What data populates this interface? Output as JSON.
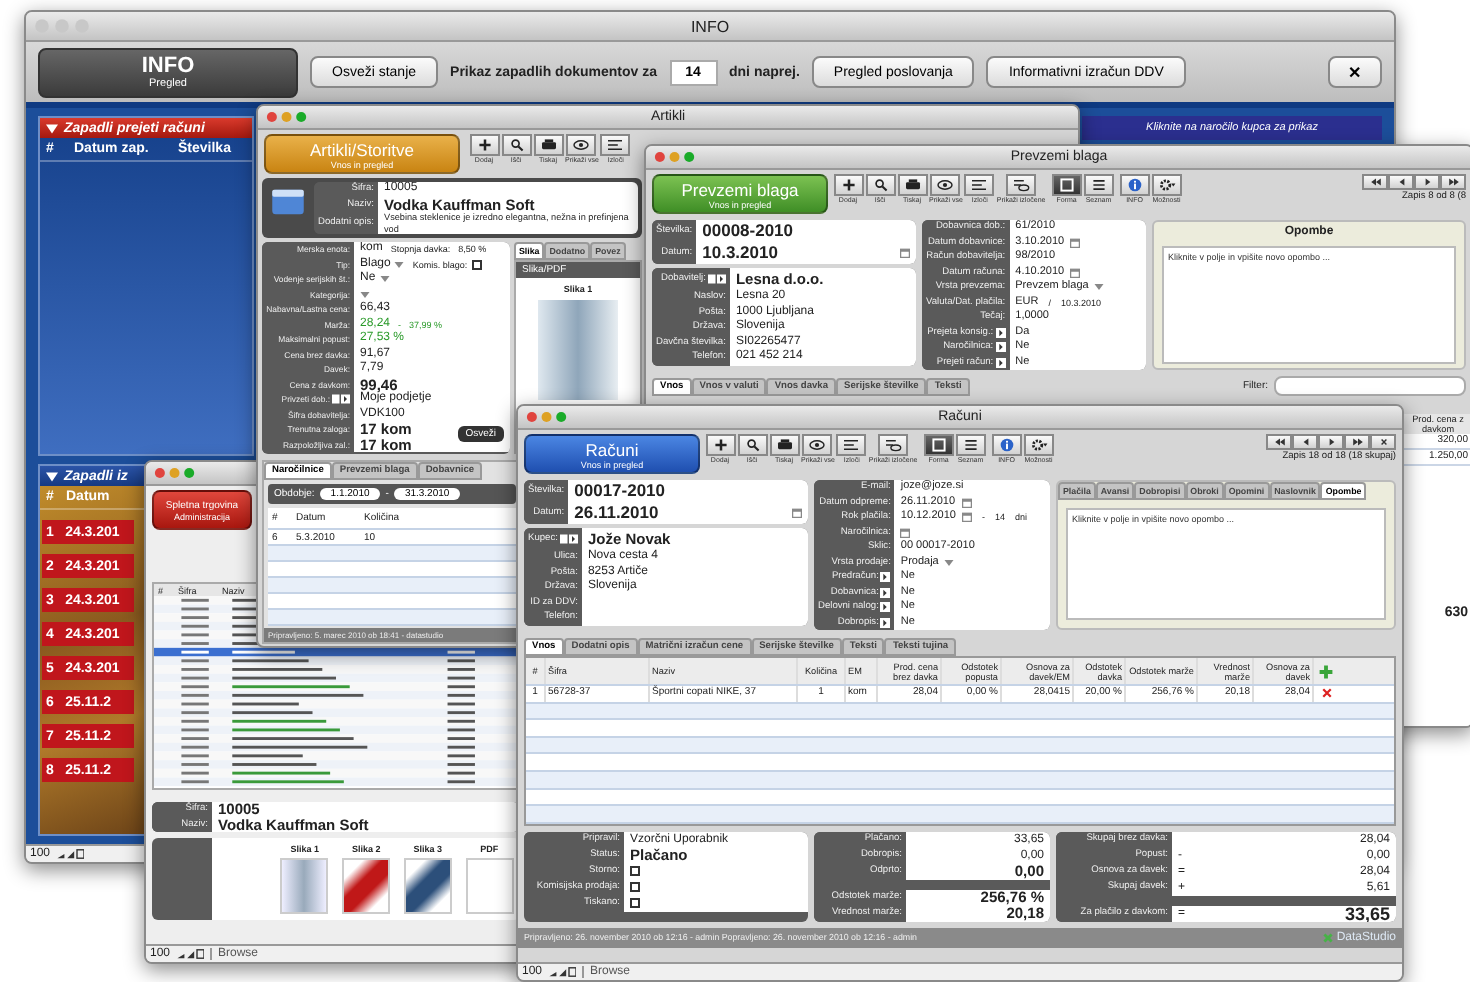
{
  "info_window": {
    "title": "INFO",
    "header": {
      "title": "INFO",
      "subtitle": "Pregled"
    },
    "refresh_button": "Osveži stanje",
    "prompt": "Prikaz zapadlih dokumentov za",
    "days": "14",
    "prompt_suffix": "dni naprej.",
    "buttons": [
      "Pregled poslovanja",
      "Informativni izračun DDV"
    ],
    "close_button": "✕",
    "overdue_received": {
      "title": "Zapadli prejeti računi",
      "columns": [
        "#",
        "Datum zap.",
        "Številka"
      ]
    },
    "overdue_issued": {
      "title": "Zapadli iz",
      "columns": [
        "#",
        "Datum"
      ],
      "rows": [
        {
          "number": "1",
          "date": "24.3.201"
        },
        {
          "number": "2",
          "date": "24.3.201"
        },
        {
          "number": "3",
          "date": "24.3.201"
        },
        {
          "number": "4",
          "date": "24.3.201"
        },
        {
          "number": "5",
          "date": "24.3.201"
        },
        {
          "number": "6",
          "date": "25.11.2"
        },
        {
          "number": "7",
          "date": "25.11.2"
        },
        {
          "number": "8",
          "date": "25.11.2"
        }
      ]
    },
    "orders_hint": "Kliknite na naročilo kupca za prikaz",
    "zoom": "100"
  },
  "items_window": {
    "title": "Artikli",
    "header": {
      "title": "Artikli/Storitve",
      "subtitle": "Vnos in pregled"
    },
    "tools": [
      {
        "kind": "add",
        "caption": "Dodaj"
      },
      {
        "kind": "search",
        "caption": "Išči"
      },
      {
        "kind": "print",
        "caption": "Tiskaj"
      },
      {
        "kind": "show",
        "caption": "Prikaži vse"
      },
      {
        "kind": "omit",
        "caption": "Izloči"
      }
    ],
    "identity": [
      {
        "label": "Šifra:",
        "value": "10005"
      },
      {
        "label": "Naziv:",
        "value": "Vodka Kauffman Soft",
        "emphasis": true
      },
      {
        "label": "Dodatni opis:",
        "value": "Vsebina steklenice je izredno elegantna, nežna in prefinjena vod"
      }
    ],
    "form": [
      {
        "label": "Merska enota:",
        "value": "kom",
        "after": [
          "Stopnja davka:",
          "8,50 %"
        ]
      },
      {
        "label": "Tip:",
        "value": "Blago",
        "kind": "dropdown",
        "after": [
          "Komis. blago:"
        ],
        "checked": false
      },
      {
        "label": "Vodenje serijskih št.:",
        "value": "Ne",
        "kind": "dropdown"
      },
      {
        "label": "Kategorija:",
        "kind": "dropdown"
      },
      {
        "label": "Nabavna/Lastna cena:",
        "value": "66,43"
      },
      {
        "label": "Marža:",
        "value": "28,24",
        "after": [
          "-",
          "37,99 %"
        ],
        "positive": true
      },
      {
        "label": "Maksimalni popust:",
        "value": "27,53 %",
        "positive": true
      },
      {
        "label": "Cena brez davka:",
        "value": "91,67"
      },
      {
        "label": "Davek:",
        "value": "7,79"
      },
      {
        "label": "Cena z davkom:",
        "value": "99,46",
        "emphasis": true
      },
      {
        "label": "Privzeti dob.:",
        "value": "Moje podjetje",
        "lookup": true
      },
      {
        "label": "Šifra dobavitelja:",
        "value": "VDK100"
      },
      {
        "label": "Trenutna zaloga:",
        "value": "17 kom",
        "emphasis": true
      },
      {
        "label": "Razpoložljiva zal.:",
        "value": "17 kom",
        "emphasis": true
      }
    ],
    "refresh_button": "Osveži",
    "side_tabs": [
      {
        "label": "Slika",
        "selected": true
      },
      {
        "label": "Dodatno",
        "selected": false
      },
      {
        "label": "Povez",
        "selected": false
      }
    ],
    "image_panel": {
      "title": "Slika/PDF",
      "caption": "Slika 1"
    },
    "tabs": [
      {
        "label": "Naročilnice",
        "selected": true
      },
      {
        "label": "Prevzemi blaga",
        "selected": false
      },
      {
        "label": "Dobavnice",
        "selected": false
      }
    ],
    "period": {
      "label": "Obdobje:",
      "from": "1.1.2010",
      "separator": "-",
      "to": "31.3.2010"
    },
    "table": {
      "columns": [
        "#",
        "Datum",
        "Količina"
      ],
      "rows": [
        [
          "6",
          "5.3.2010",
          "10"
        ]
      ]
    },
    "footer": "Pripravljeno: 5. marec 2010 ob 18:41 - datastudio"
  },
  "shop_window": {
    "header": {
      "title": "Spletna trgovina",
      "subtitle": "Administracija"
    },
    "columns": [
      "#",
      "Šifra",
      "Naziv"
    ],
    "detail": [
      {
        "label": "Šifra:",
        "value": "10005"
      },
      {
        "label": "Naziv:",
        "value": "Vodka Kauffman Soft"
      }
    ],
    "images": [
      "Slika 1",
      "Slika 2",
      "Slika 3",
      "PDF"
    ],
    "zoom": "100",
    "mode": "Browse"
  },
  "receipts_window": {
    "title": "Prevzemi blaga",
    "header": {
      "title": "Prevzemi blaga",
      "subtitle": "Vnos in pregled"
    },
    "tools": [
      {
        "kind": "add",
        "caption": "Dodaj"
      },
      {
        "kind": "search",
        "caption": "Išči"
      },
      {
        "kind": "print",
        "caption": "Tiskaj"
      },
      {
        "kind": "show",
        "caption": "Prikaži vse"
      },
      {
        "kind": "omit",
        "caption": "Izloči"
      },
      {
        "kind": "omitted",
        "caption": "Prikaži izločene"
      }
    ],
    "views": [
      {
        "kind": "form",
        "caption": "Forma",
        "selected": true
      },
      {
        "kind": "list",
        "caption": "Seznam",
        "selected": false
      }
    ],
    "options": [
      {
        "kind": "info",
        "caption": "INFO"
      },
      {
        "kind": "gear",
        "caption": "Možnosti"
      }
    ],
    "nav": [
      {
        "kind": "first"
      },
      {
        "kind": "prev"
      },
      {
        "kind": "next"
      },
      {
        "kind": "last"
      }
    ],
    "record": "Zapis 8 od 8 (8",
    "document": [
      {
        "label": "Številka:",
        "value": "00008-2010"
      },
      {
        "label": "Datum:",
        "value": "10.3.2010",
        "kind": "date"
      }
    ],
    "partner": [
      {
        "label": "Dobavitelj:",
        "value": "Lesna d.o.o.",
        "lookup": true,
        "emphasis": true
      },
      {
        "label": "Naslov:",
        "value": "Lesna 20"
      },
      {
        "label": "Pošta:",
        "value": "1000 Ljubljana"
      },
      {
        "label": "Država:",
        "value": "Slovenija"
      },
      {
        "label": "Davčna številka:",
        "value": "SI02265477"
      },
      {
        "label": "Telefon:",
        "value": "021 452 214"
      }
    ],
    "details": [
      {
        "label": "Dobavnica dob.:",
        "value": "61/2010"
      },
      {
        "label": "Datum dobavnice:",
        "value": "3.10.2010",
        "kind": "date"
      },
      {
        "label": "Račun dobavitelja:",
        "value": "98/2010"
      },
      {
        "label": "Datum računa:",
        "value": "4.10.2010",
        "kind": "date"
      },
      {
        "label": "Vrsta prevzema:",
        "value": "Prevzem blaga",
        "kind": "dropdown"
      },
      {
        "label": "Valuta/Dat. plačila:",
        "value": "EUR",
        "after": [
          "/",
          "10.3.2010"
        ]
      },
      {
        "label": "Tečaj:",
        "value": "1,0000"
      },
      {
        "label": "Prejeta konsig.:",
        "value": "Da",
        "lookup": true
      },
      {
        "label": "Naročilnica:",
        "value": "Ne",
        "lookup": true
      },
      {
        "label": "Prejeti račun:",
        "value": "Ne",
        "lookup": true
      }
    ],
    "notes": {
      "title": "Opombe",
      "placeholder": "Kliknite v polje in vpišite novo opombo ..."
    },
    "tabs": [
      {
        "label": "Vnos",
        "selected": true
      },
      {
        "label": "Vnos v valuti",
        "selected": false
      },
      {
        "label": "Vnos davka",
        "selected": false
      },
      {
        "label": "Serijske številke",
        "selected": false
      },
      {
        "label": "Teksti",
        "selected": false
      }
    ],
    "filter_label": "Filter:",
    "price_column": "Prod. cena z davkom",
    "prices": [
      "320,00",
      "1.250,00"
    ],
    "total": "630"
  },
  "invoices_window": {
    "title": "Računi",
    "header": {
      "title": "Računi",
      "subtitle": "Vnos in pregled"
    },
    "tools": [
      {
        "kind": "add",
        "caption": "Dodaj"
      },
      {
        "kind": "search",
        "caption": "Išči"
      },
      {
        "kind": "print",
        "caption": "Tiskaj"
      },
      {
        "kind": "show",
        "caption": "Prikaži vse"
      },
      {
        "kind": "omit",
        "caption": "Izloči"
      },
      {
        "kind": "omitted",
        "caption": "Prikaži izločene"
      }
    ],
    "views": [
      {
        "kind": "form",
        "caption": "Forma",
        "selected": true
      },
      {
        "kind": "list",
        "caption": "Seznam",
        "selected": false
      }
    ],
    "options": [
      {
        "kind": "info",
        "caption": "INFO"
      },
      {
        "kind": "gear",
        "caption": "Možnosti"
      }
    ],
    "nav": [
      {
        "kind": "first"
      },
      {
        "kind": "prev"
      },
      {
        "kind": "next"
      },
      {
        "kind": "last"
      },
      {
        "kind": "close"
      }
    ],
    "record": "Zapis 18 od 18 (18 skupaj)",
    "document": [
      {
        "label": "Številka:",
        "value": "00017-2010"
      },
      {
        "label": "Datum:",
        "value": "26.11.2010",
        "kind": "date"
      }
    ],
    "partner": [
      {
        "label": "Kupec:",
        "value": "Jože Novak",
        "lookup": true,
        "emphasis": true
      },
      {
        "label": "Ulica:",
        "value": "Nova cesta 4"
      },
      {
        "label": "Pošta:",
        "value": "8253 Artiče"
      },
      {
        "label": "Država:",
        "value": "Slovenija"
      },
      {
        "label": "ID za DDV:"
      },
      {
        "label": "Telefon:"
      }
    ],
    "details": [
      {
        "label": "E-mail:",
        "value": "joze@joze.si"
      },
      {
        "label": "Datum odpreme:",
        "value": "26.11.2010",
        "kind": "date"
      },
      {
        "label": "Rok plačila:",
        "value": "10.12.2010",
        "kind": "date",
        "after": [
          "-",
          "14",
          "dni"
        ]
      },
      {
        "label": "Naročilnica:",
        "kind": "date"
      },
      {
        "label": "Sklic:",
        "value": "00 00017-2010"
      },
      {
        "label": "Vrsta prodaje:",
        "value": "Prodaja",
        "kind": "dropdown"
      },
      {
        "label": "Predračun:",
        "value": "Ne",
        "lookup": true
      },
      {
        "label": "Dobavnica:",
        "value": "Ne",
        "lookup": true
      },
      {
        "label": "Delovni nalog:",
        "value": "Ne",
        "lookup": true
      },
      {
        "label": "Dobropis:",
        "value": "Ne",
        "lookup": true
      }
    ],
    "side_tabs": [
      {
        "label": "Plačila",
        "selected": false
      },
      {
        "label": "Avansi",
        "selected": false
      },
      {
        "label": "Dobropisi",
        "selected": false
      },
      {
        "label": "Obroki",
        "selected": false
      },
      {
        "label": "Opomini",
        "selected": false
      },
      {
        "label": "Naslovnik",
        "selected": false
      },
      {
        "label": "Opombe",
        "selected": true
      }
    ],
    "notes_placeholder": "Kliknite v polje in vpišite novo opombo ...",
    "tabs": [
      {
        "label": "Vnos",
        "selected": true
      },
      {
        "label": "Dodatni opis",
        "selected": false
      },
      {
        "label": "Matrični izračun cene",
        "selected": false
      },
      {
        "label": "Serijske številke",
        "selected": false
      },
      {
        "label": "Teksti",
        "selected": false
      },
      {
        "label": "Teksti tujina",
        "selected": false
      }
    ],
    "table": {
      "columns": [
        "#",
        "Šifra",
        "Naziv",
        "Količina",
        "EM",
        "Prod. cena brez davka",
        "Odstotek popusta",
        "Osnova za davek/EM",
        "Odstotek davka",
        "Odstotek marže",
        "Vrednost marže",
        "Osnova za davek"
      ],
      "rows": [
        [
          "1",
          "56728-37",
          "Športni copati NIKE, 37",
          "1",
          "kom",
          "28,04",
          "0,00 %",
          "28,0415",
          "20,00 %",
          "256,76 %",
          "20,18",
          "28,04"
        ]
      ]
    },
    "status": [
      {
        "label": "Pripravil:",
        "value": "Vzorčni Uporabnik"
      },
      {
        "label": "Status:",
        "value": "Plačano",
        "emphasis": true
      },
      {
        "label": "Storno:",
        "checked": false
      },
      {
        "label": "Komisijska prodaja:",
        "checked": false
      },
      {
        "label": "Tiskano:",
        "checked": false
      }
    ],
    "payments": [
      {
        "label": "Plačano:",
        "value": "33,65"
      },
      {
        "label": "Dobropis:",
        "value": "0,00"
      },
      {
        "label": "Odprto:",
        "value": "0,00",
        "emphasis": true
      },
      {
        "label": "Odstotek marže:",
        "value": "256,76 %",
        "emphasis": true
      },
      {
        "label": "Vrednost marže:",
        "value": "20,18",
        "emphasis": true
      }
    ],
    "totals": [
      {
        "label": "Skupaj brez davka:",
        "value": "28,04"
      },
      {
        "label": "Popust:",
        "sign": "-",
        "value": "0,00"
      },
      {
        "label": "Osnova za davek:",
        "sign": "=",
        "value": "28,04"
      },
      {
        "label": "Skupaj davek:",
        "sign": "+",
        "value": "5,61"
      },
      {
        "label": "Za plačilo z davkom:",
        "sign": "=",
        "value": "33,65",
        "emphasis": true
      }
    ],
    "footer": "Pripravljeno: 26. november 2010 ob 12:16 - admin   Popravljeno: 26. november 2010 ob 12:16 - admin",
    "brand": "DataStudio",
    "zoom": "100",
    "mode": "Browse"
  }
}
